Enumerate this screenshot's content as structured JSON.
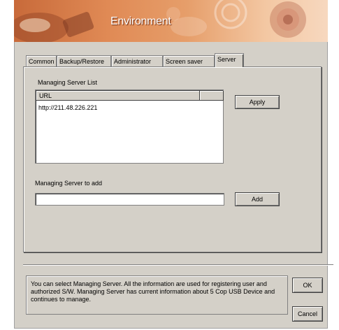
{
  "window": {
    "title": "Environment"
  },
  "tabs": [
    {
      "label": "Common",
      "active": false
    },
    {
      "label": "Backup/Restore",
      "active": false
    },
    {
      "label": "Administrator",
      "active": false
    },
    {
      "label": "Screen saver",
      "active": false
    },
    {
      "label": "Server",
      "active": true
    }
  ],
  "server_list": {
    "group_label": "Managing Server List",
    "columns": [
      "URL",
      ""
    ],
    "rows": [
      "http://211.48.226.221"
    ]
  },
  "apply_label": "Apply",
  "add_section": {
    "label": "Managing Server to add",
    "value": "",
    "button_label": "Add"
  },
  "info_text": "You can select Managing Server. All the information are used for registering user and authorized S/W. Managing Server has current information about 5 Cop USB Device and continues to manage.",
  "ok_label": "OK",
  "cancel_label": "Cancel",
  "colors": {
    "dialog_bg": "#d4d0c8",
    "banner_start": "#c86a3a",
    "banner_end": "#f7d8bf"
  }
}
